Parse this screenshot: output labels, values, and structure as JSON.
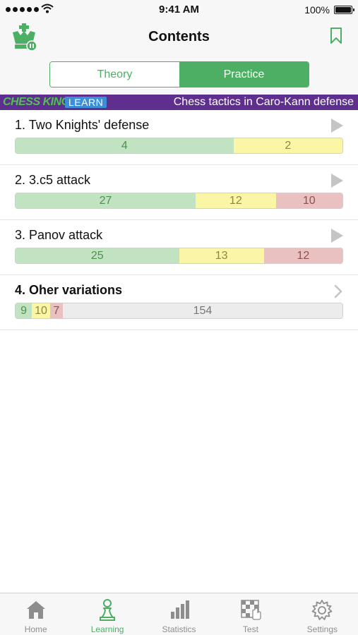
{
  "status_bar": {
    "time": "9:41 AM",
    "battery": "100%"
  },
  "nav": {
    "title": "Contents"
  },
  "segments": {
    "theory": "Theory",
    "practice": "Practice",
    "selected": "Practice"
  },
  "banner": {
    "brand": "CHESS KING",
    "learn": "LEARN",
    "title": "Chess tactics in Caro-Kann defense"
  },
  "colors": {
    "accent": "#4caf63",
    "banner_bg": "#5f2f8f",
    "green": "#c2e3c2",
    "yellow": "#fbf5a6",
    "red": "#e9c1c1",
    "gray": "#ececec"
  },
  "chapters": [
    {
      "title": "1. Two Knights' defense",
      "icon": "play-icon",
      "segments": [
        {
          "kind": "green",
          "value": "4",
          "count": 4
        },
        {
          "kind": "yellow",
          "value": "2",
          "count": 2
        }
      ]
    },
    {
      "title": "2. 3.c5 attack",
      "icon": "play-icon",
      "segments": [
        {
          "kind": "green",
          "value": "27",
          "count": 27
        },
        {
          "kind": "yellow",
          "value": "12",
          "count": 12
        },
        {
          "kind": "red",
          "value": "10",
          "count": 10
        }
      ]
    },
    {
      "title": "3. Panov attack",
      "icon": "play-icon",
      "segments": [
        {
          "kind": "green",
          "value": "25",
          "count": 25
        },
        {
          "kind": "yellow",
          "value": "13",
          "count": 13
        },
        {
          "kind": "red",
          "value": "12",
          "count": 12
        }
      ]
    },
    {
      "title": "4. Oher variations",
      "icon": "chevron-right-icon",
      "segments": [
        {
          "kind": "green",
          "value": "9",
          "count": 9
        },
        {
          "kind": "yellow",
          "value": "10",
          "count": 10
        },
        {
          "kind": "red",
          "value": "7",
          "count": 7
        },
        {
          "kind": "gray",
          "value": "154",
          "count": 154
        }
      ]
    }
  ],
  "tabs": [
    {
      "label": "Home",
      "icon": "home-icon"
    },
    {
      "label": "Learning",
      "icon": "pawn-icon",
      "active": true
    },
    {
      "label": "Statistics",
      "icon": "bar-chart-icon"
    },
    {
      "label": "Test",
      "icon": "chessboard-hand-icon"
    },
    {
      "label": "Settings",
      "icon": "gear-icon"
    }
  ]
}
